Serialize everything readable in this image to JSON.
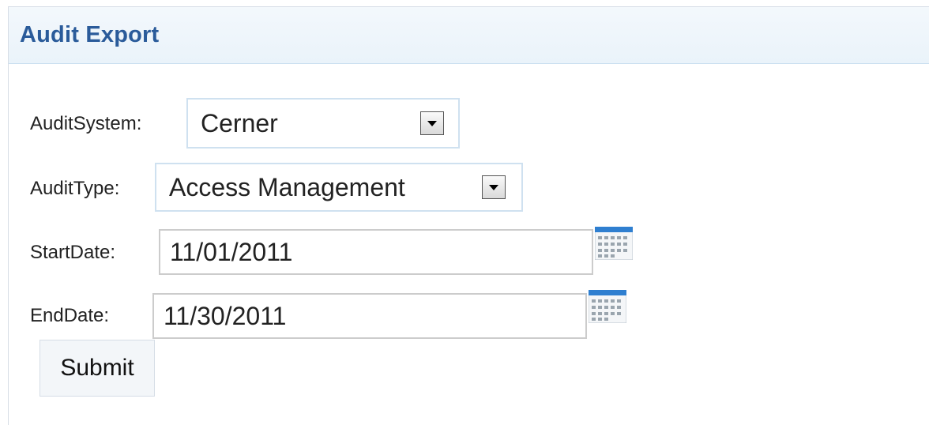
{
  "panel": {
    "title": "Audit Export"
  },
  "form": {
    "audit_system": {
      "label": "AuditSystem:",
      "value": "Cerner"
    },
    "audit_type": {
      "label": "AuditType:",
      "value": "Access Management"
    },
    "start_date": {
      "label": "StartDate:",
      "value": "11/01/2011"
    },
    "end_date": {
      "label": "EndDate:",
      "value": "11/30/2011"
    },
    "submit_label": "Submit"
  },
  "icons": {
    "dropdown": "chevron-down-icon",
    "calendar": "calendar-icon"
  },
  "colors": {
    "title": "#2a5b9a",
    "header_bg": "#eaf3fa",
    "select_border": "#cfe1f0"
  }
}
